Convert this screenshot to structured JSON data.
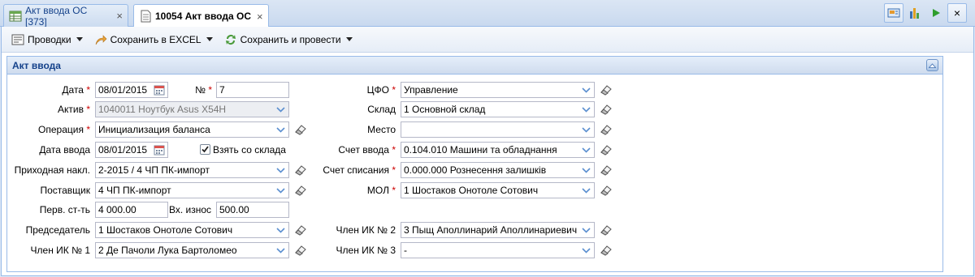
{
  "tabs": [
    {
      "label": "Акт ввода ОС [373]",
      "close": "×"
    },
    {
      "label": "10054 Акт ввода ОС",
      "close": "×"
    }
  ],
  "top_icons": [
    "report-icon",
    "chart-icon",
    "play-icon",
    "close-icon"
  ],
  "top_close": "×",
  "toolbar": {
    "postings": "Проводки",
    "save_excel": "Сохранить в EXCEL",
    "save_post": "Сохранить и провести"
  },
  "form": {
    "title": "Акт ввода",
    "date": {
      "label": "Дата",
      "value": "08/01/2015"
    },
    "number": {
      "label": "№",
      "value": "7"
    },
    "asset": {
      "label": "Актив",
      "value": "1040011 Ноутбук Asus X54H"
    },
    "operation": {
      "label": "Операция",
      "value": "Инициализация баланса"
    },
    "input_date": {
      "label": "Дата ввода",
      "value": "08/01/2015"
    },
    "take_from_warehouse": {
      "label": "Взять со склада",
      "checked": true
    },
    "receipt": {
      "label": "Приходная накл.",
      "value": "2-2015 / 4 ЧП ПК-импорт"
    },
    "supplier": {
      "label": "Поставщик",
      "value": "4 ЧП ПК-импорт"
    },
    "initial_cost": {
      "label": "Перв. ст-ть",
      "value": "4 000.00"
    },
    "input_wear": {
      "label": "Вх. износ",
      "value": "500.00"
    },
    "chairman": {
      "label": "Председатель",
      "value": "1 Шостаков Онотоле Сотович"
    },
    "member1": {
      "label": "Член ИК № 1",
      "value": "2 Де Пачоли Лука Бартоломео"
    },
    "cfo": {
      "label": "ЦФО",
      "value": "Управление"
    },
    "warehouse": {
      "label": "Склад",
      "value": "1 Основной склад"
    },
    "place": {
      "label": "Место",
      "value": ""
    },
    "input_account": {
      "label": "Счет ввода",
      "value": "0.104.010 Машини та обладнання"
    },
    "writeoff_account": {
      "label": "Счет списания",
      "value": "0.000.000 Рознесення залишків"
    },
    "mol": {
      "label": "МОЛ",
      "value": "1 Шостаков Онотоле Сотович"
    },
    "member2": {
      "label": "Член ИК № 2",
      "value": "3 Пыщ Аполлинарий Аполлинариевич"
    },
    "member3": {
      "label": "Член ИК № 3",
      "value": "-"
    }
  }
}
